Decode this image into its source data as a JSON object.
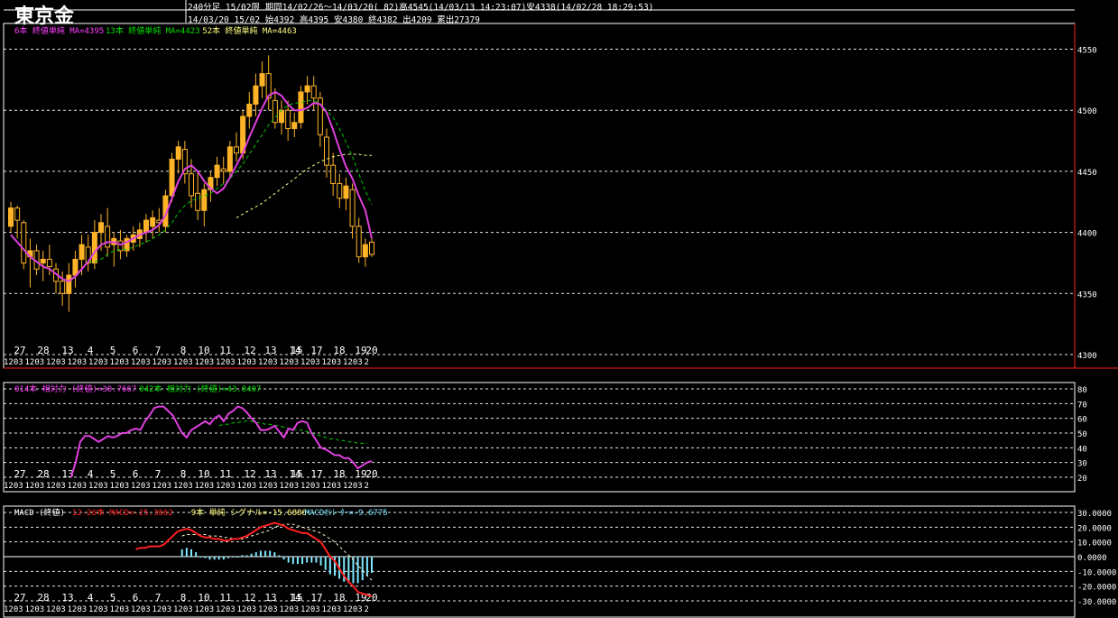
{
  "app": {
    "title": "東京金"
  },
  "header": {
    "line1": "240分足 15/02限 期間14/02/26〜14/03/20( 82)高4545(14/03/13 14:23:07)安4338(14/02/28 18:29:53)",
    "line2": "14/03/20 15/02 始4392 高4395 安4380 終4382 出4209 累出27379"
  },
  "colors": {
    "background": "#000000",
    "up_candle": "#ffb428",
    "ma_short": "#e040e0",
    "ma_mid": "#00c800",
    "ma_long": "#ffff80",
    "macd": "#ff2020",
    "signal": "#ffffd0",
    "oscillator": "#80e8ff",
    "grid": "#ffffff",
    "frame": "#ff2020"
  },
  "chart_data": [
    {
      "panel": "price",
      "type": "candlestick",
      "legend": [
        {
          "text": "6本 終値単純 MA=4395",
          "color": "#ff40ff"
        },
        {
          "text": "13本 終値単純 MA=4423",
          "color": "#00e000"
        },
        {
          "text": "52本 終値単純 MA=4463",
          "color": "#ffff80"
        }
      ],
      "ylim": [
        4300,
        4560
      ],
      "y_ticks": [
        "4550",
        "4500",
        "4450",
        "4400",
        "4350",
        "4300"
      ],
      "x_labels": [
        "27",
        "28",
        "13",
        "4",
        "5",
        "6",
        "7",
        "8",
        "10",
        "11",
        "12",
        "13",
        "14",
        "15",
        "17",
        "18",
        "19",
        "20"
      ],
      "x_sub_labels": [
        "1203",
        "1203",
        "1203",
        "1203",
        "1203",
        "1203",
        "1203",
        "1203",
        "1203",
        "1203",
        "1203",
        "1203",
        "1203",
        "1203",
        "1203",
        "1203",
        "1203",
        "2"
      ],
      "candles": [
        [
          4405,
          4425,
          4400,
          4420
        ],
        [
          4420,
          4422,
          4395,
          4410
        ],
        [
          4408,
          4410,
          4370,
          4375
        ],
        [
          4380,
          4395,
          4355,
          4385
        ],
        [
          4385,
          4390,
          4365,
          4370
        ],
        [
          4375,
          4385,
          4360,
          4378
        ],
        [
          4378,
          4390,
          4365,
          4372
        ],
        [
          4370,
          4375,
          4350,
          4360
        ],
        [
          4360,
          4368,
          4340,
          4350
        ],
        [
          4350,
          4375,
          4335,
          4365
        ],
        [
          4365,
          4385,
          4355,
          4378
        ],
        [
          4378,
          4398,
          4365,
          4390
        ],
        [
          4388,
          4398,
          4368,
          4375
        ],
        [
          4375,
          4410,
          4370,
          4400
        ],
        [
          4400,
          4415,
          4385,
          4408
        ],
        [
          4405,
          4420,
          4380,
          4388
        ],
        [
          4390,
          4400,
          4372,
          4395
        ],
        [
          4393,
          4402,
          4378,
          4385
        ],
        [
          4385,
          4398,
          4380,
          4395
        ],
        [
          4392,
          4405,
          4385,
          4398
        ],
        [
          4395,
          4408,
          4388,
          4402
        ],
        [
          4400,
          4415,
          4392,
          4410
        ],
        [
          4405,
          4418,
          4395,
          4412
        ],
        [
          4410,
          4420,
          4400,
          4408
        ],
        [
          4405,
          4435,
          4400,
          4430
        ],
        [
          4430,
          4465,
          4425,
          4460
        ],
        [
          4460,
          4475,
          4448,
          4470
        ],
        [
          4468,
          4475,
          4440,
          4448
        ],
        [
          4448,
          4460,
          4420,
          4430
        ],
        [
          4432,
          4450,
          4410,
          4418
        ],
        [
          4418,
          4440,
          4405,
          4435
        ],
        [
          4435,
          4450,
          4425,
          4445
        ],
        [
          4445,
          4462,
          4438,
          4455
        ],
        [
          4452,
          4462,
          4440,
          4450
        ],
        [
          4450,
          4475,
          4445,
          4470
        ],
        [
          4470,
          4482,
          4458,
          4465
        ],
        [
          4465,
          4500,
          4460,
          4495
        ],
        [
          4495,
          4515,
          4485,
          4505
        ],
        [
          4505,
          4530,
          4495,
          4520
        ],
        [
          4520,
          4540,
          4510,
          4530
        ],
        [
          4530,
          4545,
          4500,
          4510
        ],
        [
          4508,
          4518,
          4485,
          4490
        ],
        [
          4490,
          4508,
          4480,
          4500
        ],
        [
          4500,
          4508,
          4475,
          4485
        ],
        [
          4485,
          4498,
          4478,
          4490
        ],
        [
          4490,
          4520,
          4485,
          4515
        ],
        [
          4515,
          4528,
          4505,
          4520
        ],
        [
          4520,
          4528,
          4500,
          4510
        ],
        [
          4510,
          4515,
          4470,
          4480
        ],
        [
          4478,
          4485,
          4445,
          4455
        ],
        [
          4455,
          4465,
          4430,
          4440
        ],
        [
          4440,
          4448,
          4420,
          4428
        ],
        [
          4428,
          4445,
          4418,
          4438
        ],
        [
          4435,
          4440,
          4395,
          4405
        ],
        [
          4405,
          4412,
          4375,
          4380
        ],
        [
          4380,
          4395,
          4372,
          4390
        ],
        [
          4392,
          4395,
          4380,
          4382
        ]
      ],
      "ma6": [
        4398,
        4392,
        4386,
        4380,
        4376,
        4372,
        4370,
        4366,
        4362,
        4360,
        4364,
        4370,
        4376,
        4384,
        4390,
        4392,
        4392,
        4390,
        4392,
        4395,
        4398,
        4400,
        4402,
        4406,
        4414,
        4428,
        4442,
        4452,
        4455,
        4450,
        4442,
        4436,
        4432,
        4436,
        4445,
        4455,
        4465,
        4478,
        4490,
        4502,
        4512,
        4515,
        4512,
        4505,
        4500,
        4500,
        4502,
        4506,
        4505,
        4498,
        4484,
        4468,
        4454,
        4444,
        4430,
        4418,
        4395
      ],
      "ma13": [
        null,
        null,
        null,
        null,
        null,
        null,
        null,
        null,
        null,
        null,
        null,
        null,
        4376,
        4376,
        4378,
        4382,
        4385,
        4386,
        4386,
        4388,
        4390,
        4392,
        4395,
        4398,
        4402,
        4408,
        4416,
        4422,
        4426,
        4428,
        4430,
        4432,
        4436,
        4440,
        4444,
        4450,
        4456,
        4464,
        4472,
        4480,
        4488,
        4494,
        4500,
        4504,
        4506,
        4506,
        4508,
        4508,
        4505,
        4500,
        4494,
        4485,
        4474,
        4462,
        4448,
        4434,
        4423
      ],
      "ma52": [
        null,
        null,
        null,
        null,
        null,
        null,
        null,
        null,
        null,
        null,
        null,
        null,
        null,
        null,
        null,
        null,
        null,
        null,
        null,
        null,
        null,
        null,
        null,
        null,
        null,
        null,
        null,
        null,
        null,
        null,
        null,
        null,
        null,
        null,
        null,
        4412,
        4415,
        4418,
        4421,
        4424,
        4428,
        4432,
        4436,
        4440,
        4444,
        4448,
        4452,
        4455,
        4458,
        4460,
        4462,
        4463,
        4464,
        4464,
        4464,
        4463,
        4463
      ]
    },
    {
      "panel": "rsi",
      "type": "line",
      "legend": [
        {
          "text": "014本 相対力 (終値)=30.7667",
          "color": "#ff40ff"
        },
        {
          "text": "042本 相対力 (終値)=43.8407",
          "color": "#00e000"
        }
      ],
      "ylim": [
        20,
        80
      ],
      "y_ticks": [
        "80",
        "70",
        "60",
        "50",
        "40",
        "30",
        "20"
      ],
      "rsi14": [
        null,
        null,
        null,
        null,
        null,
        null,
        null,
        null,
        null,
        null,
        null,
        null,
        null,
        20,
        30,
        44,
        48,
        48,
        46,
        44,
        46,
        48,
        47,
        48,
        50,
        50,
        52,
        53,
        52,
        58,
        62,
        67,
        68,
        68,
        65,
        62,
        56,
        50,
        47,
        52,
        54,
        56,
        58,
        56,
        60,
        62,
        58,
        63,
        65,
        68,
        67,
        64,
        60,
        57,
        52,
        52,
        53,
        55,
        51,
        47,
        53,
        52,
        57,
        58,
        57,
        50,
        45,
        40,
        39,
        37,
        35,
        35,
        33,
        33,
        30,
        26,
        28,
        30,
        31
      ],
      "rsi42": [
        null,
        null,
        null,
        null,
        null,
        null,
        null,
        null,
        null,
        null,
        null,
        null,
        null,
        null,
        null,
        null,
        null,
        null,
        null,
        null,
        null,
        null,
        null,
        null,
        null,
        null,
        null,
        null,
        null,
        null,
        null,
        null,
        null,
        null,
        null,
        null,
        null,
        null,
        null,
        null,
        null,
        null,
        null,
        null,
        null,
        55,
        56,
        56,
        57,
        57,
        58,
        58,
        58,
        57,
        57,
        56,
        56,
        55,
        55,
        54,
        53,
        53,
        52,
        52,
        51,
        50,
        49,
        48,
        47,
        46,
        46,
        45,
        45,
        44,
        44,
        43,
        43,
        43
      ]
    },
    {
      "panel": "macd",
      "type": "line+bar",
      "legend": [
        {
          "text": "MACD (終値)",
          "color": "#ffffff"
        },
        {
          "text": "12-26本 MACD=-25.3662",
          "color": "#ff2020"
        },
        {
          "text": "9本 単純 シグナル=-15.6886",
          "color": "#ffff80"
        },
        {
          "text": "MACDｵｼﾚｰﾀｰ=-9.6775",
          "color": "#80e8ff"
        }
      ],
      "ylim": [
        -30,
        30
      ],
      "y_ticks": [
        "30.0000",
        "20.0000",
        "10.0000",
        "0.0000",
        "-10.0000",
        "-20.0000",
        "-30.0000"
      ],
      "macd": [
        null,
        null,
        null,
        null,
        null,
        null,
        null,
        null,
        null,
        null,
        null,
        null,
        null,
        null,
        null,
        null,
        null,
        null,
        null,
        null,
        null,
        null,
        null,
        null,
        null,
        null,
        null,
        5,
        6,
        6,
        7,
        7,
        7,
        8,
        11,
        14,
        17,
        18,
        19,
        18,
        16,
        14,
        13,
        13,
        12,
        12,
        11,
        11,
        12,
        12,
        13,
        14,
        16,
        18,
        20,
        21,
        22,
        23,
        22,
        21,
        19,
        18,
        17,
        16,
        16,
        14,
        12,
        10,
        5,
        0,
        -3,
        -8,
        -13,
        -17,
        -20,
        -24,
        -25,
        -26,
        -27
      ],
      "signal": [
        null,
        null,
        null,
        null,
        null,
        null,
        null,
        null,
        null,
        null,
        null,
        null,
        null,
        null,
        null,
        null,
        null,
        null,
        null,
        null,
        null,
        null,
        null,
        null,
        null,
        null,
        null,
        null,
        null,
        null,
        null,
        null,
        null,
        null,
        null,
        null,
        null,
        14,
        15,
        15,
        15,
        15,
        15,
        14,
        14,
        14,
        13,
        13,
        12,
        12,
        12,
        13,
        14,
        15,
        16,
        17,
        18,
        20,
        21,
        22,
        22,
        22,
        21,
        20,
        19,
        18,
        17,
        16,
        14,
        12,
        10,
        7,
        4,
        1,
        -2,
        -6,
        -9,
        -13,
        -16
      ],
      "histogram": [
        null,
        null,
        null,
        null,
        null,
        null,
        null,
        null,
        null,
        null,
        null,
        null,
        null,
        null,
        null,
        null,
        null,
        null,
        null,
        null,
        null,
        null,
        null,
        null,
        null,
        null,
        null,
        null,
        null,
        null,
        null,
        null,
        null,
        null,
        null,
        null,
        null,
        5,
        6,
        5,
        3,
        0,
        -1,
        -2,
        -2,
        -2,
        -2,
        -1,
        0,
        0,
        1,
        1,
        2,
        3,
        4,
        4,
        4,
        3,
        1,
        -2,
        -4,
        -5,
        -5,
        -5,
        -4,
        -4,
        -4,
        -6,
        -9,
        -12,
        -13,
        -15,
        -17,
        -18,
        -18,
        -18,
        -16,
        -13,
        -11
      ]
    }
  ]
}
